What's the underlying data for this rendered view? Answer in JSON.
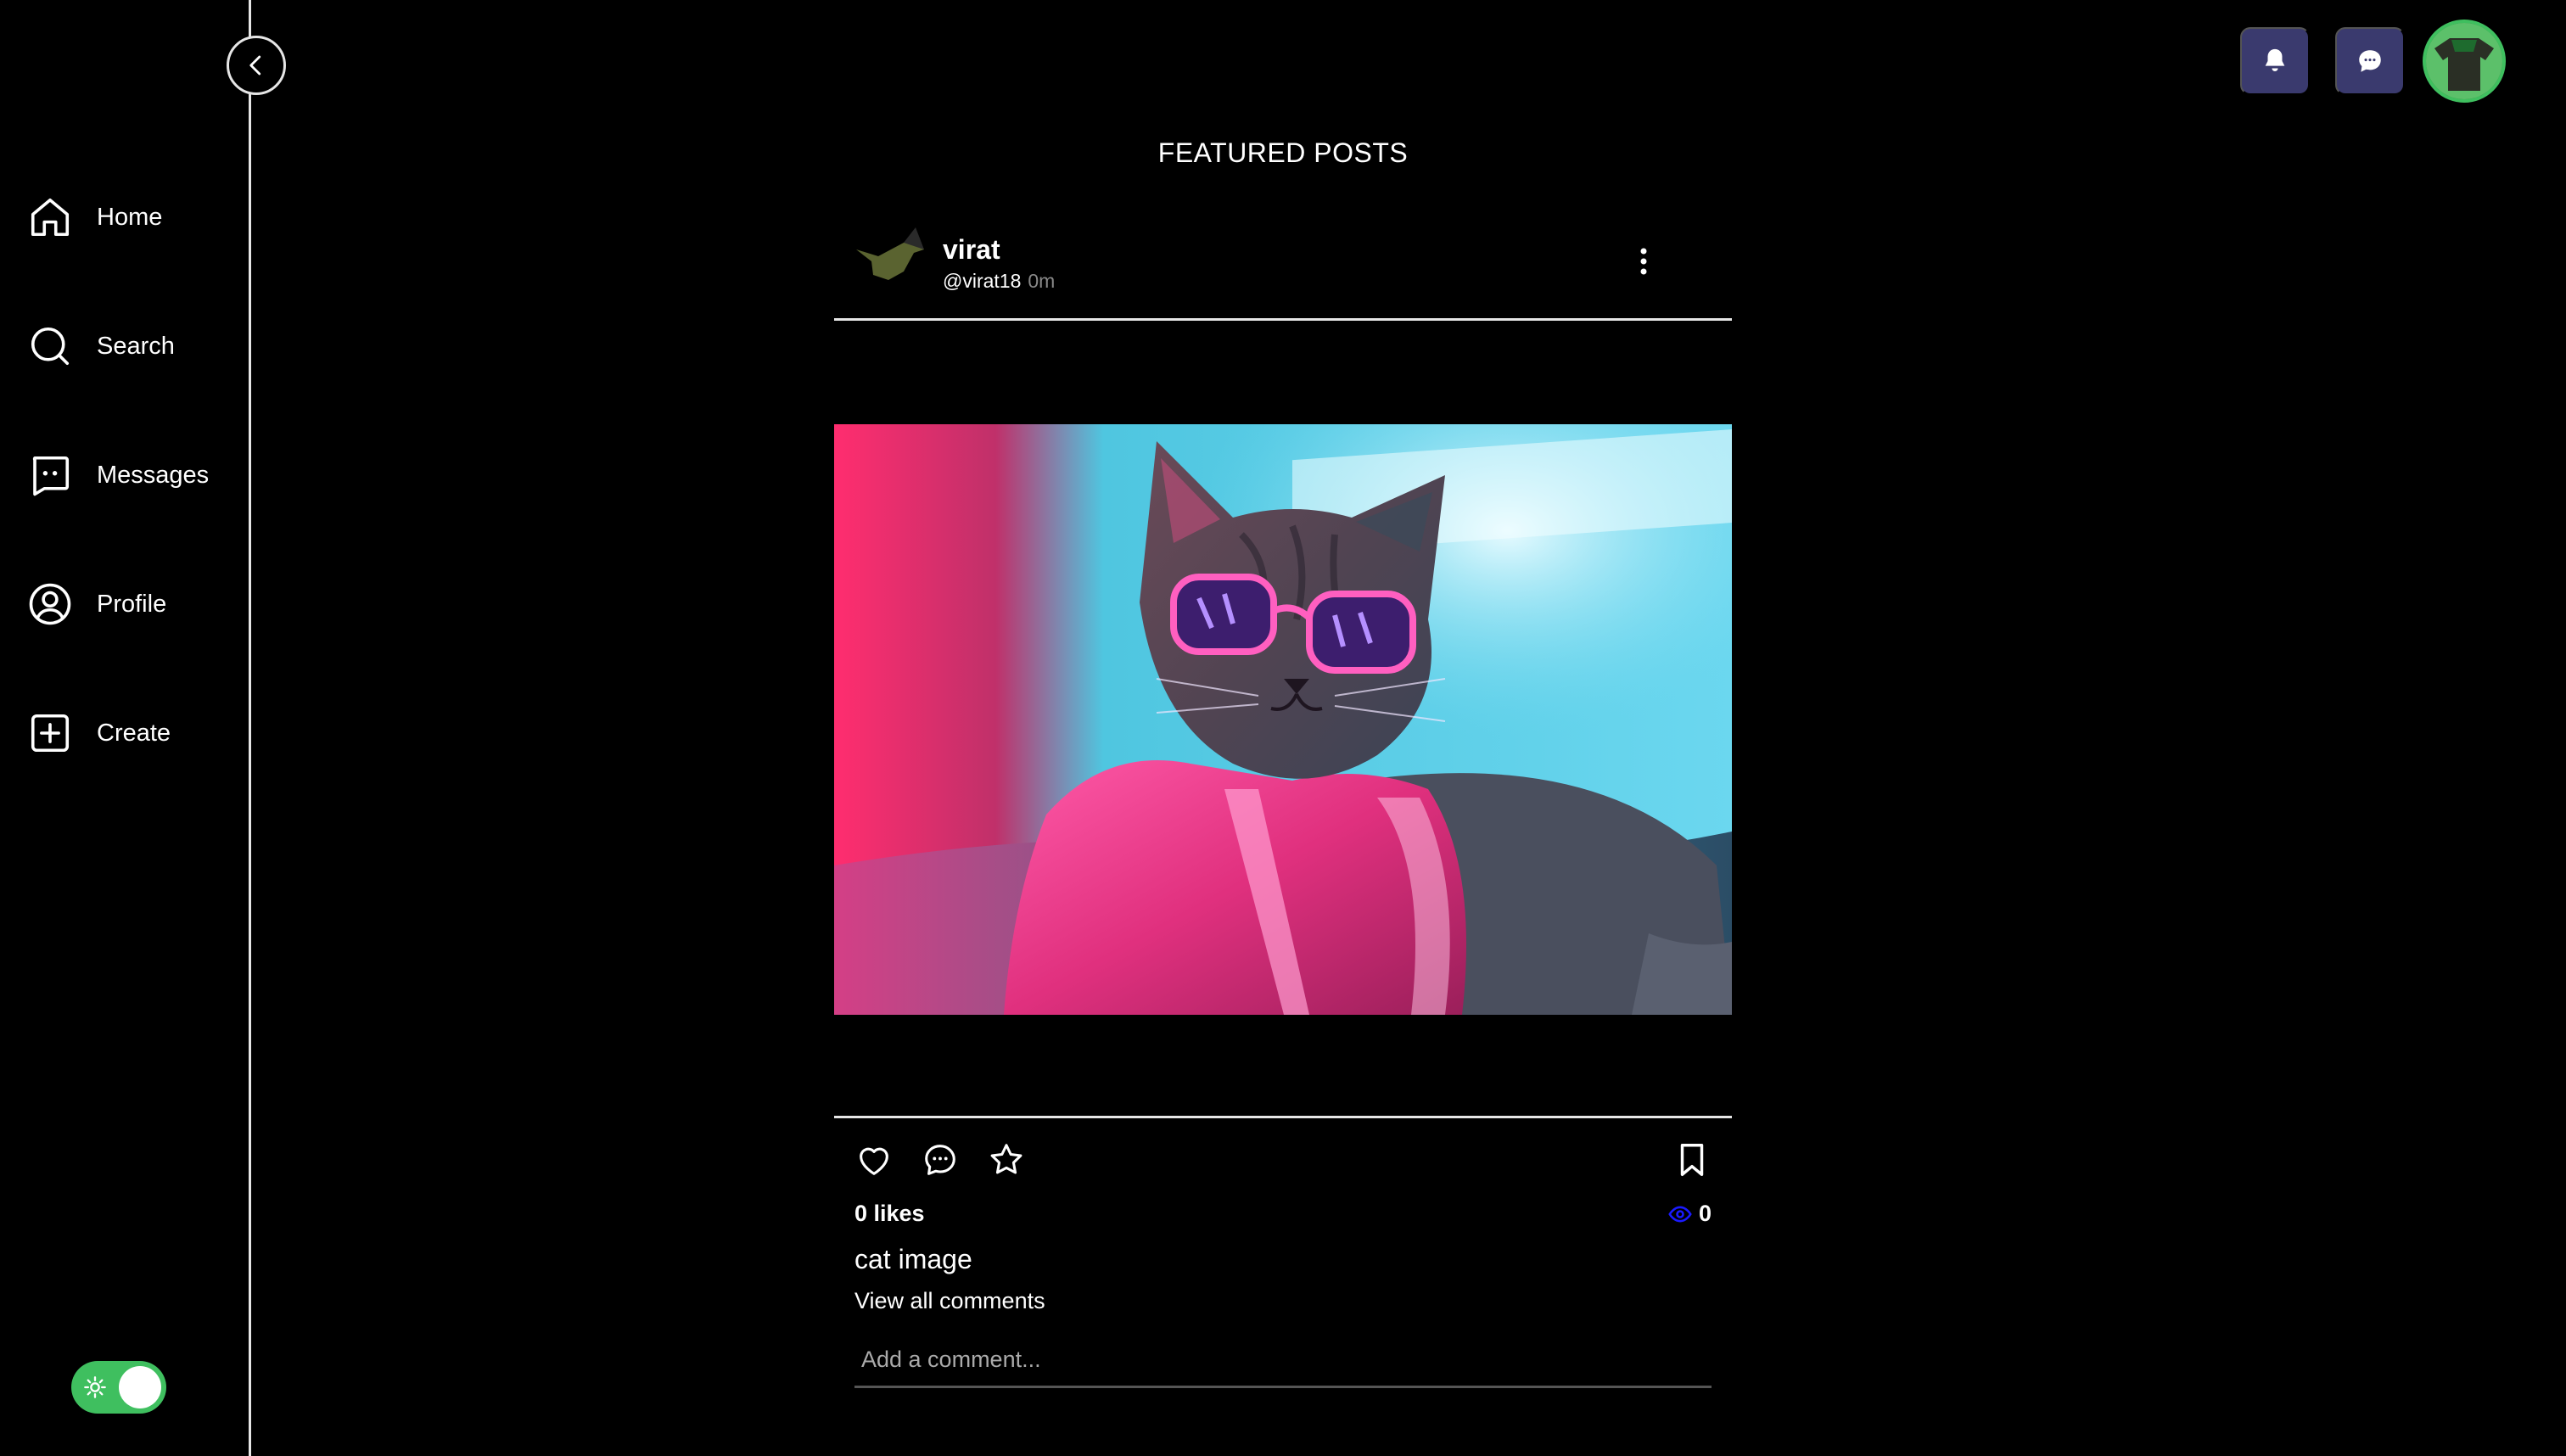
{
  "sidebar": {
    "items": [
      {
        "label": "Home",
        "icon": "home-icon"
      },
      {
        "label": "Search",
        "icon": "search-icon"
      },
      {
        "label": "Messages",
        "icon": "message-icon"
      },
      {
        "label": "Profile",
        "icon": "user-icon"
      },
      {
        "label": "Create",
        "icon": "plus-square-icon"
      }
    ]
  },
  "header": {
    "notifications_icon": "bell-icon",
    "messages_icon": "chat-bubble-icon",
    "avatar_icon": "avatar"
  },
  "feed": {
    "title": "FEATURED POSTS"
  },
  "post": {
    "author_name": "virat",
    "author_handle": "@virat18",
    "time": "0m",
    "likes_text": "0 likes",
    "views_count": "0",
    "caption": "cat image",
    "view_comments": "View all comments",
    "comment_placeholder": "Add a comment..."
  },
  "colors": {
    "background": "#000000",
    "accent_green": "#3fbf5f",
    "top_button_bg": "#3a3a6e",
    "views_icon": "#1a1aff"
  }
}
